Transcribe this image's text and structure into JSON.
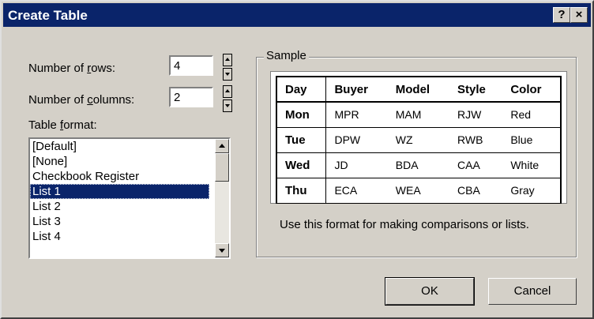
{
  "window": {
    "title": "Create Table",
    "help_label": "?",
    "close_label": "×"
  },
  "rows": {
    "label_pre": "Number of ",
    "label_key": "r",
    "label_post": "ows:",
    "value": "4"
  },
  "columns": {
    "label_pre": "Number of ",
    "label_key": "c",
    "label_post": "olumns:",
    "value": "2"
  },
  "format": {
    "label_pre": "Table ",
    "label_key": "f",
    "label_post": "ormat:",
    "items": [
      "[Default]",
      "[None]",
      "Checkbook Register",
      "List 1",
      "List 2",
      "List 3",
      "List 4"
    ],
    "selected": "List 1"
  },
  "sample": {
    "legend": "Sample",
    "headers": [
      "Day",
      "Buyer",
      "Model",
      "Style",
      "Color"
    ],
    "rows": [
      [
        "Mon",
        "MPR",
        "MAM",
        "RJW",
        "Red"
      ],
      [
        "Tue",
        "DPW",
        "WZ",
        "RWB",
        "Blue"
      ],
      [
        "Wed",
        "JD",
        "BDA",
        "CAA",
        "White"
      ],
      [
        "Thu",
        "ECA",
        "WEA",
        "CBA",
        "Gray"
      ]
    ],
    "description": "Use this format for making comparisons or lists."
  },
  "buttons": {
    "ok": "OK",
    "cancel": "Cancel"
  },
  "colors": {
    "titlebar": "#0a246a",
    "face": "#d4d0c8",
    "selection": "#0a246a"
  }
}
